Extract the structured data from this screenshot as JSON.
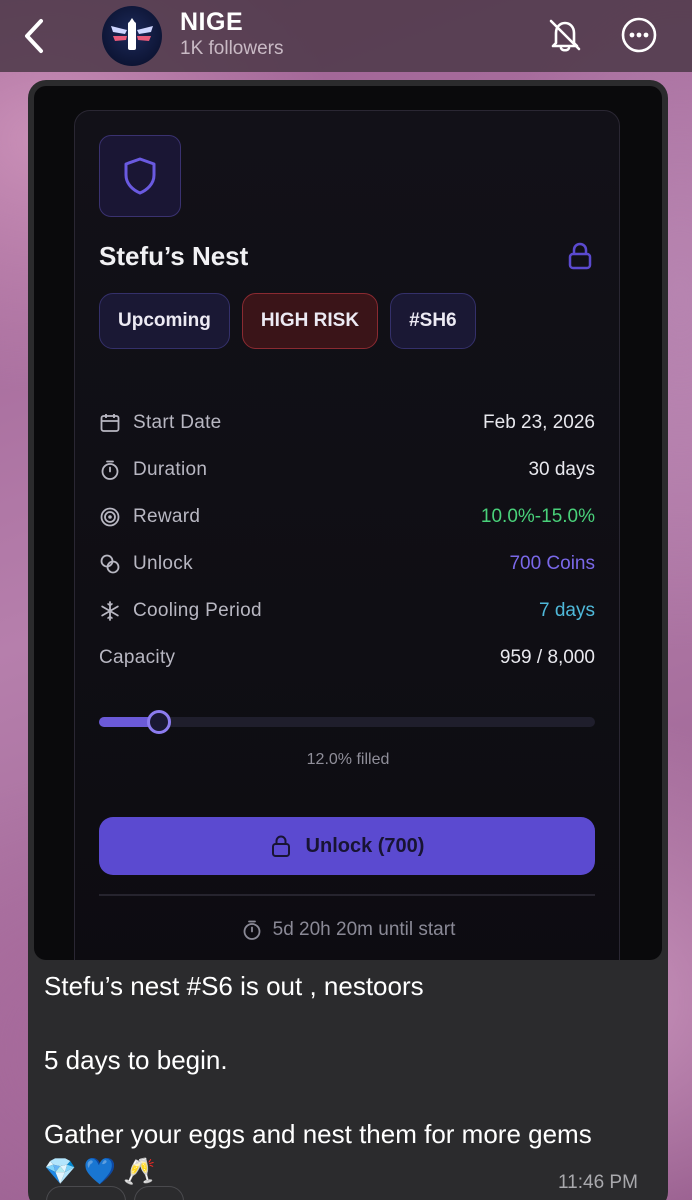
{
  "header": {
    "title": "NIGE",
    "subtitle": "1K followers",
    "icons": {
      "back": "chevron-left-icon",
      "mute": "bell-slash-icon",
      "more": "ellipsis-circle-icon"
    }
  },
  "card": {
    "title": "Stefu’s Nest",
    "tags": {
      "status": "Upcoming",
      "risk": "HIGH RISK",
      "code": "#SH6"
    },
    "rows": [
      {
        "label": "Start Date",
        "value": "Feb 23, 2026",
        "icon": "calendar-icon"
      },
      {
        "label": "Duration",
        "value": "30 days",
        "icon": "stopwatch-icon"
      },
      {
        "label": "Reward",
        "value": "10.0%-15.0%",
        "icon": "target-icon"
      },
      {
        "label": "Unlock",
        "value": "700 Coins",
        "icon": "coins-icon"
      },
      {
        "label": "Cooling Period",
        "value": "7 days",
        "icon": "snowflake-icon"
      },
      {
        "label": "Capacity",
        "value": "959 / 8,000"
      }
    ],
    "progress_fraction": 0.12,
    "filled_text": "12.0% filled",
    "unlock_button": "Unlock (700)",
    "countdown": "5d 20h 20m until start",
    "colors": {
      "accent": "#5b4ad0",
      "reward": "#49d17a",
      "unlock": "#7a68e8",
      "cooling": "#4fb8d9",
      "risk": "#8a2a31"
    }
  },
  "message": {
    "lines": [
      "Stefu’s nest #S6 is out , nestoors",
      "",
      "5 days to begin.",
      "",
      "Gather your eggs and nest them for more gems",
      "💎 💙 🥂"
    ],
    "time": "11:46 PM"
  }
}
